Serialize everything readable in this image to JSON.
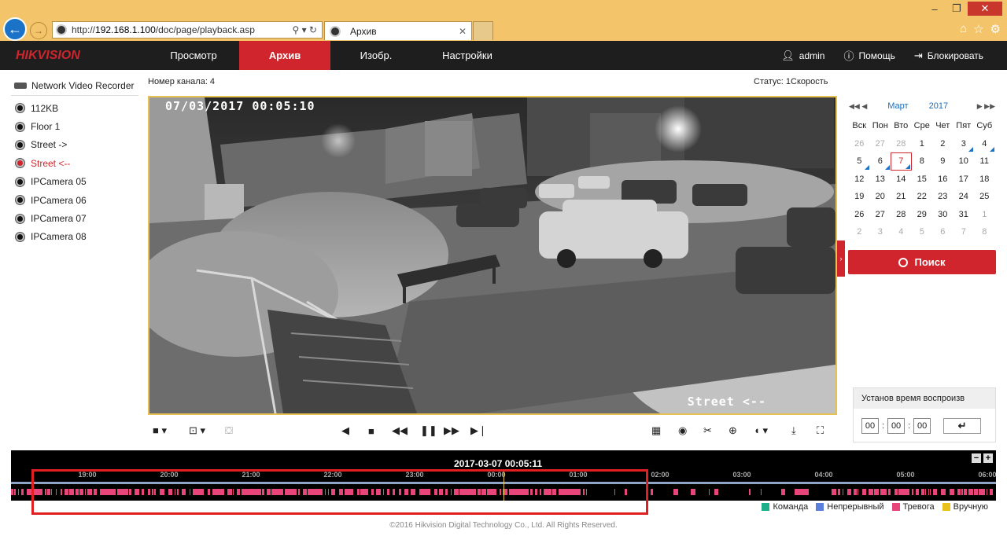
{
  "browser": {
    "url_prefix": "http://",
    "url_host": "192.168.1.100",
    "url_path": "/doc/page/playback.asp",
    "addr_icons": "⚲ ▾ ↻",
    "tab_title": "Архив"
  },
  "header": {
    "logo": "HIKVISION",
    "nav": [
      {
        "label": "Просмотр",
        "active": false
      },
      {
        "label": "Архив",
        "active": true
      },
      {
        "label": "Изобр.",
        "active": false
      },
      {
        "label": "Настройки",
        "active": false
      }
    ],
    "user": "admin",
    "help": "Помощь",
    "lock": "Блокировать"
  },
  "tree": {
    "root": "Network Video Recorder",
    "items": [
      "112KB",
      "Floor 1",
      "Street ->",
      "Street <--",
      "IPCamera 05",
      "IPCamera 06",
      "IPCamera 07",
      "IPCamera 08"
    ],
    "selected_index": 3
  },
  "video": {
    "channel_label": "Номер канала: 4",
    "status_label": "Статус: 1Скорость",
    "osd_time": "07/03/2017 00:05:10",
    "osd_name": "Street <--"
  },
  "calendar": {
    "month": "Март",
    "year": "2017",
    "weekdays": [
      "Вск",
      "Пон",
      "Вто",
      "Сре",
      "Чет",
      "Пят",
      "Суб"
    ],
    "days": [
      {
        "d": "26",
        "other": true
      },
      {
        "d": "27",
        "other": true
      },
      {
        "d": "28",
        "other": true
      },
      {
        "d": "1"
      },
      {
        "d": "2"
      },
      {
        "d": "3",
        "rec": true
      },
      {
        "d": "4",
        "rec": true
      },
      {
        "d": "5",
        "rec": true
      },
      {
        "d": "6",
        "rec": true
      },
      {
        "d": "7",
        "rec": true,
        "today": true
      },
      {
        "d": "8"
      },
      {
        "d": "9"
      },
      {
        "d": "10"
      },
      {
        "d": "11"
      },
      {
        "d": "12"
      },
      {
        "d": "13"
      },
      {
        "d": "14"
      },
      {
        "d": "15"
      },
      {
        "d": "16"
      },
      {
        "d": "17"
      },
      {
        "d": "18"
      },
      {
        "d": "19"
      },
      {
        "d": "20"
      },
      {
        "d": "21"
      },
      {
        "d": "22"
      },
      {
        "d": "23"
      },
      {
        "d": "24"
      },
      {
        "d": "25"
      },
      {
        "d": "26"
      },
      {
        "d": "27"
      },
      {
        "d": "28"
      },
      {
        "d": "29"
      },
      {
        "d": "30"
      },
      {
        "d": "31"
      },
      {
        "d": "1",
        "other": true
      },
      {
        "d": "2",
        "other": true
      },
      {
        "d": "3",
        "other": true
      },
      {
        "d": "4",
        "other": true
      },
      {
        "d": "5",
        "other": true
      },
      {
        "d": "6",
        "other": true
      },
      {
        "d": "7",
        "other": true
      },
      {
        "d": "8",
        "other": true
      }
    ],
    "search_label": "Поиск"
  },
  "settime": {
    "title": "Установ время воспроизв",
    "hh": "00",
    "mm": "00",
    "ss": "00"
  },
  "timeline": {
    "current": "2017-03-07 00:05:11",
    "ticks": [
      "19:00",
      "20:00",
      "21:00",
      "22:00",
      "23:00",
      "00:00",
      "01:00",
      "02:00",
      "03:00",
      "04:00",
      "05:00",
      "06:00"
    ],
    "legend": [
      {
        "label": "Команда",
        "color": "#1bb08a"
      },
      {
        "label": "Непрерывный",
        "color": "#5b7fdc"
      },
      {
        "label": "Тревога",
        "color": "#e8457a"
      },
      {
        "label": "Вручную",
        "color": "#e8c21b"
      }
    ]
  },
  "footer": "©2016 Hikvision Digital Technology Co., Ltd. All Rights Reserved."
}
